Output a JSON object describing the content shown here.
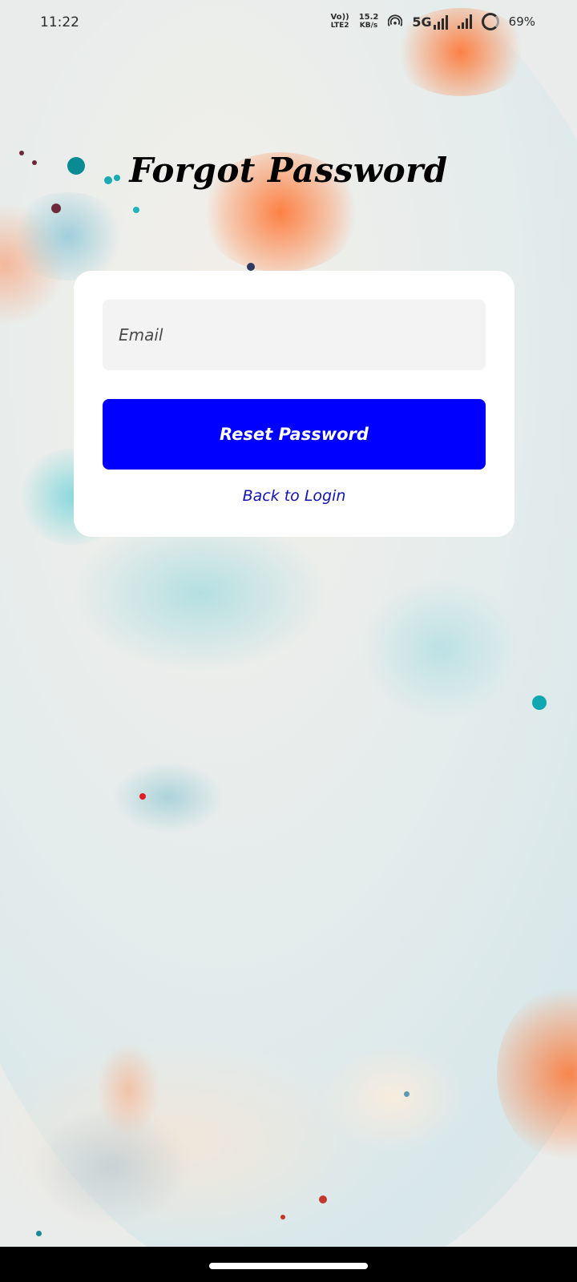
{
  "status_bar": {
    "time": "11:22",
    "volte_top": "Vo))",
    "volte_bottom": "LTE2",
    "speed_value": "15.2",
    "speed_unit": "KB/s",
    "network": "5G",
    "battery": "69%"
  },
  "page": {
    "title": "Forgot Password"
  },
  "form": {
    "email_placeholder": "Email",
    "email_value": "",
    "reset_button_label": "Reset Password",
    "back_link_label": "Back to Login"
  },
  "colors": {
    "accent": "#0000ff",
    "link": "#1212b8",
    "card": "#ffffff",
    "input_bg": "#f3f3f3"
  }
}
